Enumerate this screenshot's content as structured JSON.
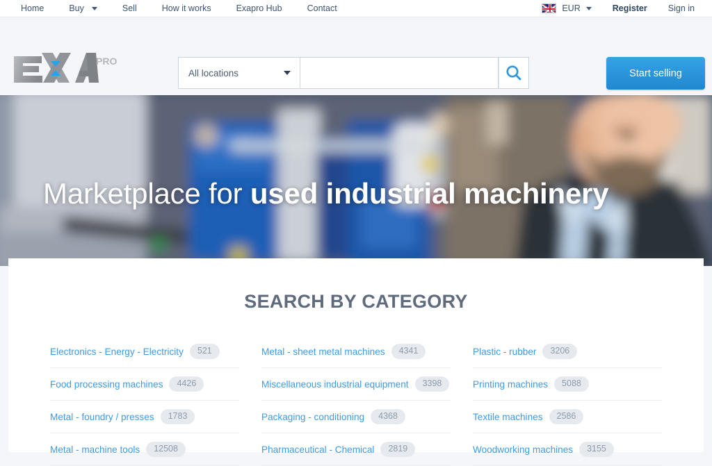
{
  "topbar": {
    "nav": [
      {
        "label": "Home",
        "has_caret": false
      },
      {
        "label": "Buy",
        "has_caret": true
      },
      {
        "label": "Sell",
        "has_caret": false
      },
      {
        "label": "How it works",
        "has_caret": false
      },
      {
        "label": "Exapro Hub",
        "has_caret": false
      },
      {
        "label": "Contact",
        "has_caret": false
      }
    ],
    "currency": "EUR",
    "flag_icon": "uk-flag-icon",
    "register": "Register",
    "signin": "Sign in"
  },
  "header": {
    "logo_main": "EXA",
    "logo_sub": "PRO",
    "location_value": "All locations",
    "search_value": "",
    "search_placeholder": "",
    "search_icon": "search-icon",
    "start_selling": "Start selling"
  },
  "hero": {
    "title_normal": "Marketplace for ",
    "title_bold": "used industrial machinery"
  },
  "main": {
    "section_title": "SEARCH BY CATEGORY",
    "columns": [
      [
        {
          "name": "Electronics - Energy - Electricity",
          "count": "521"
        },
        {
          "name": "Food processing machines",
          "count": "4426"
        },
        {
          "name": "Metal - foundry / presses",
          "count": "1783"
        },
        {
          "name": "Metal - machine tools",
          "count": "12508"
        }
      ],
      [
        {
          "name": "Metal - sheet metal machines",
          "count": "4341"
        },
        {
          "name": "Miscellaneous industrial equipment",
          "count": "3398"
        },
        {
          "name": "Packaging - conditioning",
          "count": "4368"
        },
        {
          "name": "Pharmaceutical - Chemical",
          "count": "2819"
        }
      ],
      [
        {
          "name": "Plastic - rubber",
          "count": "3206"
        },
        {
          "name": "Printing machines",
          "count": "5088"
        },
        {
          "name": "Textile machines",
          "count": "2586"
        },
        {
          "name": "Woodworking machines",
          "count": "3155"
        }
      ]
    ]
  },
  "colors": {
    "accent_blue": "#3d9ae8",
    "link_blue": "#3b5573",
    "button_blue": "#2088cf",
    "heading_gray": "#5f6b7d",
    "page_bg": "#f4f6f9"
  }
}
